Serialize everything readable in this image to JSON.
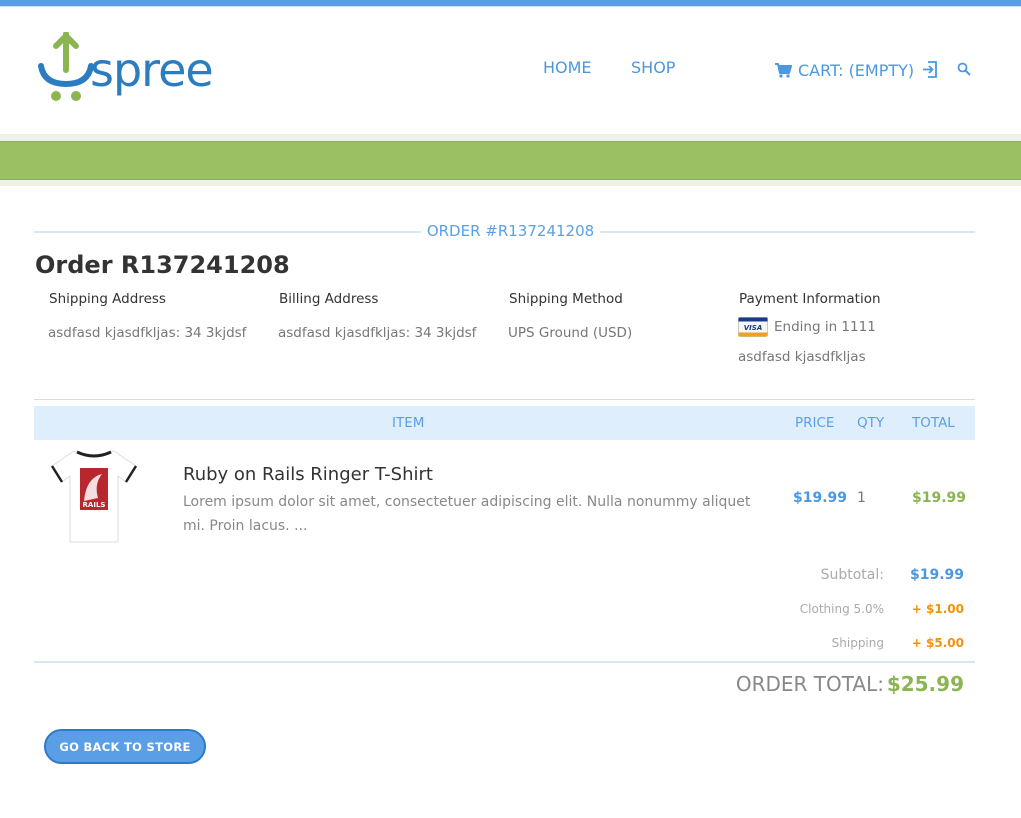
{
  "header": {
    "logo_text": "spree",
    "nav": {
      "home": "HOME",
      "shop": "SHOP",
      "cart": "CART: (EMPTY)"
    },
    "icons": {
      "cart": "cart-icon",
      "login": "login-icon",
      "search": "search-icon"
    }
  },
  "order": {
    "section_title": "ORDER #R137241208",
    "heading": "Order R137241208",
    "shipping_address": {
      "label": "Shipping Address",
      "value": "asdfasd kjasdfkljas: 34 3kjdsf"
    },
    "billing_address": {
      "label": "Billing Address",
      "value": "asdfasd kjasdfkljas: 34 3kjdsf"
    },
    "shipping_method": {
      "label": "Shipping Method",
      "value": "UPS Ground (USD)"
    },
    "payment": {
      "label": "Payment Information",
      "card_ending": "Ending in 1111",
      "name": "asdfasd kjasdfkljas",
      "card_brand": "VISA"
    }
  },
  "table": {
    "headers": {
      "item": "ITEM",
      "price": "PRICE",
      "qty": "QTY",
      "total": "TOTAL"
    },
    "rows": [
      {
        "name": "Ruby on Rails Ringer T-Shirt",
        "description": "Lorem ipsum dolor sit amet, consectetuer adipiscing elit. Nulla nonummy aliquet mi. Proin lacus. ...",
        "price": "$19.99",
        "qty": "1",
        "total": "$19.99",
        "image_badge": "RAILS"
      }
    ]
  },
  "summary": {
    "subtotal_label": "Subtotal:",
    "subtotal_value": "$19.99",
    "tax_label": "Clothing 5.0%",
    "tax_value": "+ $1.00",
    "shipping_label": "Shipping",
    "shipping_value": "+ $5.00",
    "order_total_label": "ORDER TOTAL:",
    "order_total_value": "$25.99"
  },
  "actions": {
    "back_button": "GO BACK TO STORE"
  },
  "colors": {
    "brand_blue": "#5a9fe6",
    "brand_green": "#9bc063",
    "accent_orange": "#f0920c"
  }
}
